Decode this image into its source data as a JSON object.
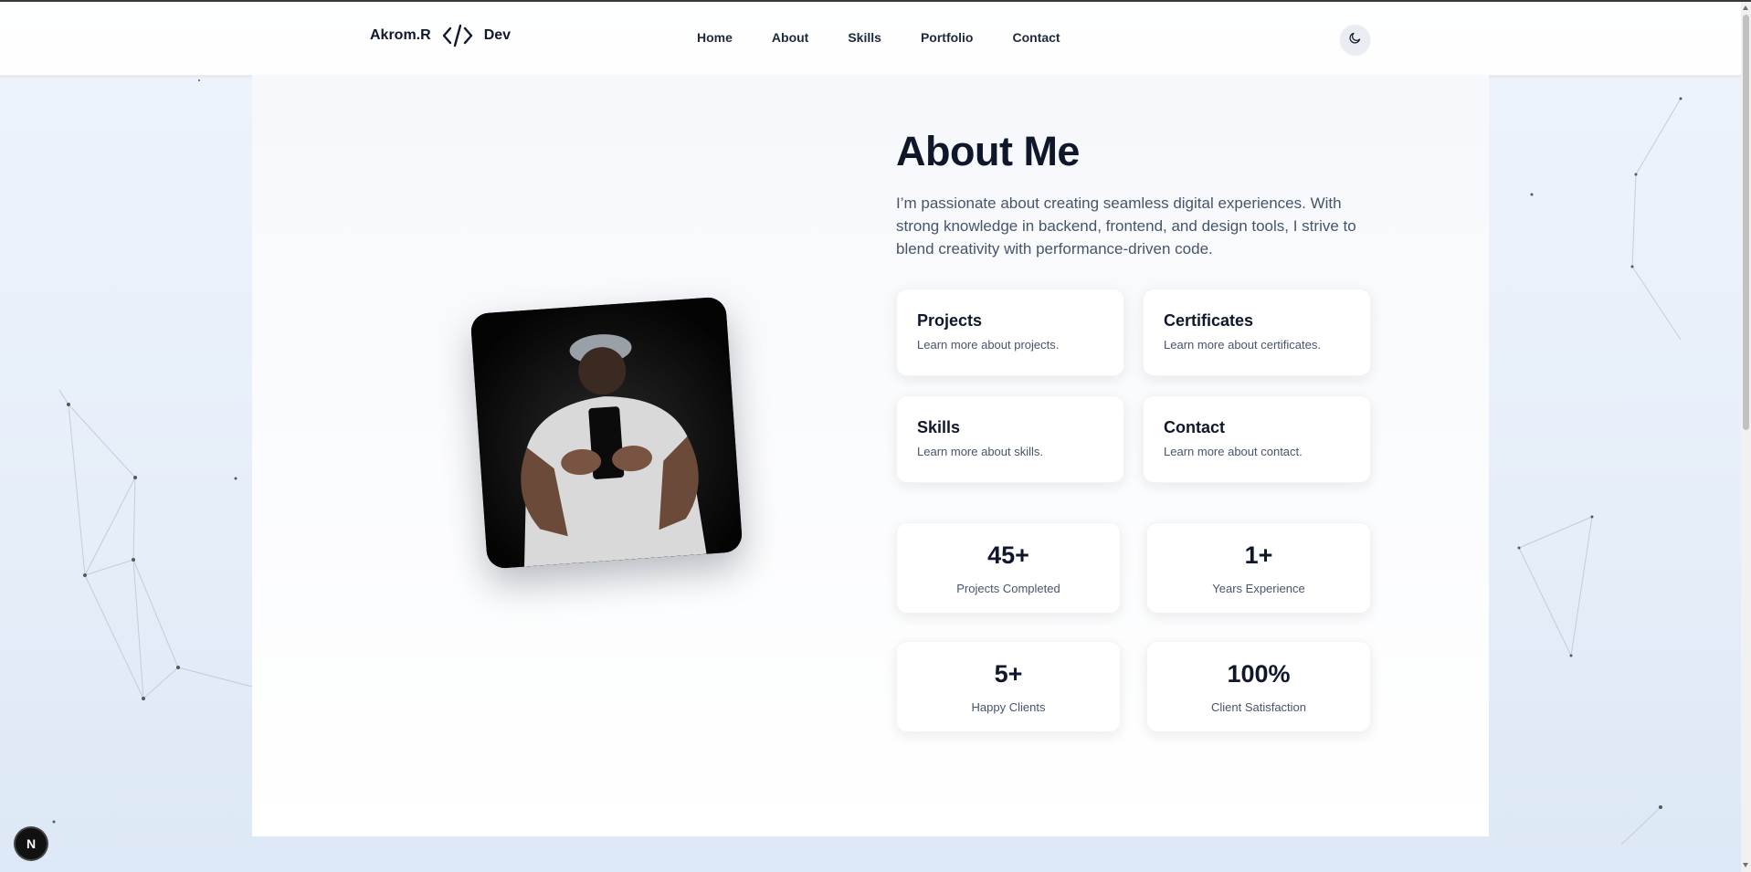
{
  "header": {
    "logo_left": "Akrom.R",
    "logo_icon": "code-icon",
    "logo_right": "Dev",
    "nav": [
      "Home",
      "About",
      "Skills",
      "Portfolio",
      "Contact"
    ],
    "theme_icon": "moon-icon"
  },
  "about": {
    "title": "About Me",
    "description": "I’m passionate about creating seamless digital experiences. With strong knowledge in backend, frontend, and design tools, I strive to blend creativity with performance-driven code.",
    "cards": [
      {
        "title": "Projects",
        "desc": "Learn more about projects."
      },
      {
        "title": "Certificates",
        "desc": "Learn more about certificates."
      },
      {
        "title": "Skills",
        "desc": "Learn more about skills."
      },
      {
        "title": "Contact",
        "desc": "Learn more about contact."
      }
    ],
    "stats": [
      {
        "value": "45+",
        "label": "Projects Completed"
      },
      {
        "value": "1+",
        "label": "Years Experience"
      },
      {
        "value": "5+",
        "label": "Happy Clients"
      },
      {
        "value": "100%",
        "label": "Client Satisfaction"
      }
    ]
  },
  "badge": "N",
  "colors": {
    "accent": "#0f172a",
    "muted": "#475569",
    "background": "#e6eef9"
  }
}
